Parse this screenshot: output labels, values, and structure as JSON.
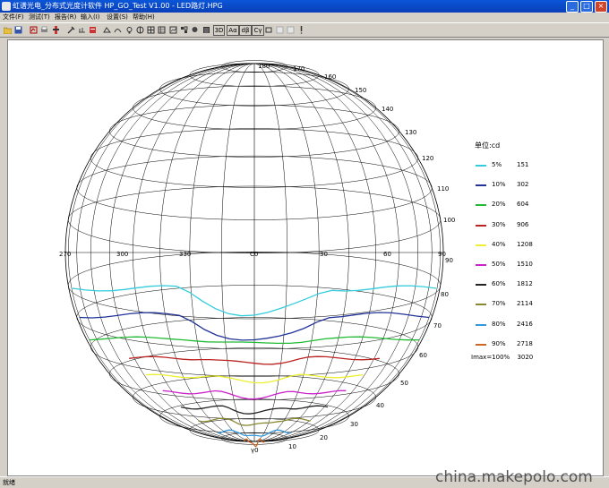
{
  "window": {
    "title": "虹谱光电_分布式光度计软件 HP_GO_Test V1.00 - LED路灯.HPG",
    "buttons": [
      "_",
      "□",
      "×"
    ]
  },
  "menu": [
    "文件(F)",
    "测试(T)",
    "报告(R)",
    "输入(I)",
    "设置(S)",
    "帮助(H)"
  ],
  "toolbar": {
    "text_buttons": [
      "3D",
      "Aα",
      "dβ",
      "Cγ"
    ]
  },
  "plot": {
    "top_labels": [
      "180",
      "170",
      "160",
      "150",
      "140",
      "130",
      "120",
      "110",
      "100",
      "90"
    ],
    "left_labels": [
      "270",
      "300",
      "330",
      "C0",
      "30",
      "60"
    ],
    "right_labels": [
      "90",
      "80",
      "70",
      "60",
      "50",
      "40",
      "30",
      "20",
      "10"
    ],
    "bottom_label": "γ0"
  },
  "legend": {
    "title": "单位:cd",
    "items": [
      {
        "pct": "5%",
        "val": "151",
        "color": "#33ccdd"
      },
      {
        "pct": "10%",
        "val": "302",
        "color": "#223399"
      },
      {
        "pct": "20%",
        "val": "604",
        "color": "#22bb33"
      },
      {
        "pct": "30%",
        "val": "906",
        "color": "#bb2222"
      },
      {
        "pct": "40%",
        "val": "1208",
        "color": "#eeee33"
      },
      {
        "pct": "50%",
        "val": "1510",
        "color": "#cc22cc"
      },
      {
        "pct": "60%",
        "val": "1812",
        "color": "#222222"
      },
      {
        "pct": "70%",
        "val": "2114",
        "color": "#888833"
      },
      {
        "pct": "80%",
        "val": "2416",
        "color": "#3399dd"
      },
      {
        "pct": "90%",
        "val": "2718",
        "color": "#cc6622"
      }
    ],
    "imax_label": "Imax=100%",
    "imax_value": "3020"
  },
  "status": "就绪",
  "watermark": "china.makepolo.com"
}
